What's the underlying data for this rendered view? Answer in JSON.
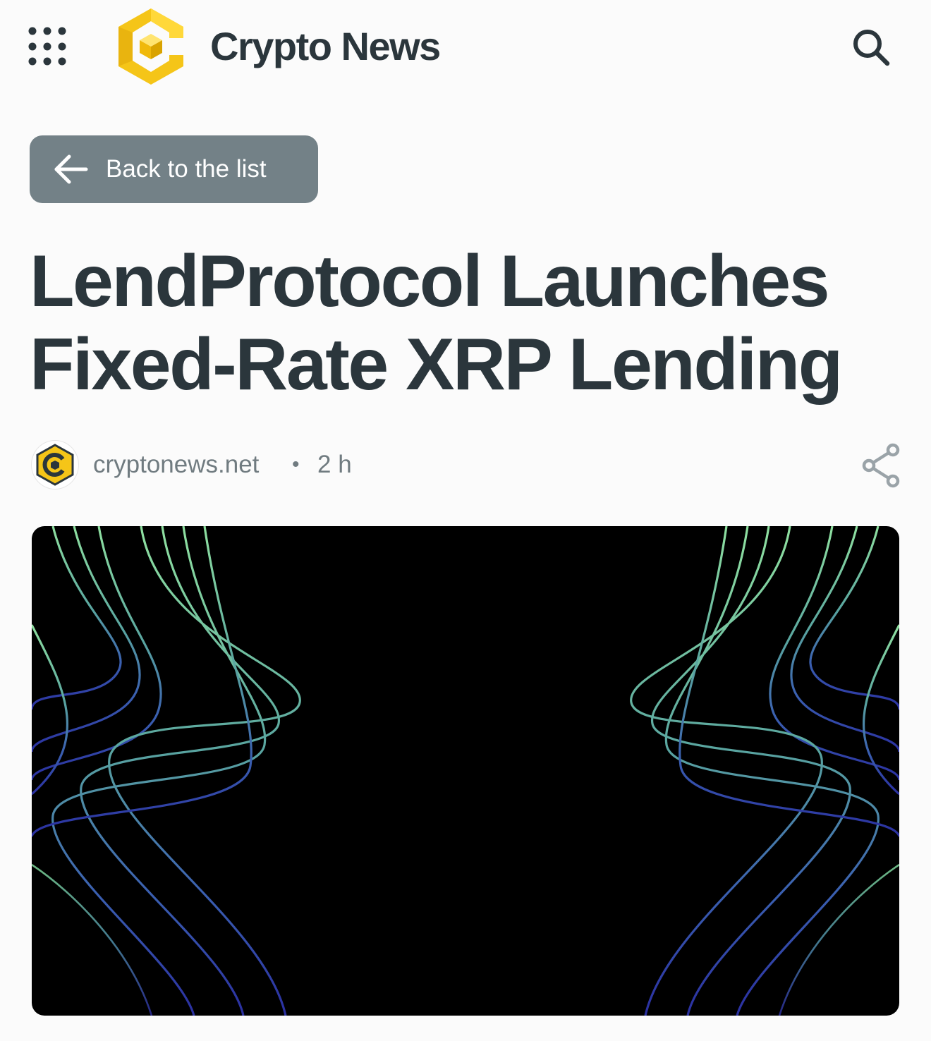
{
  "header": {
    "brand": "Crypto News",
    "menu_icon": "grid-dots-icon",
    "search_icon": "search-icon"
  },
  "back": {
    "label": "Back to the list",
    "icon": "arrow-left-icon"
  },
  "article": {
    "title": "LendProtocol Launches Fixed-Rate XRP Lending",
    "source": "cryptonews.net",
    "separator": "•",
    "time": "2 h",
    "share_icon": "share-icon"
  },
  "colors": {
    "brand_yellow": "#f5c518",
    "text_dark": "#2b363c",
    "text_muted": "#707b80",
    "button_bg": "#738187",
    "hero_bg": "#000000"
  }
}
